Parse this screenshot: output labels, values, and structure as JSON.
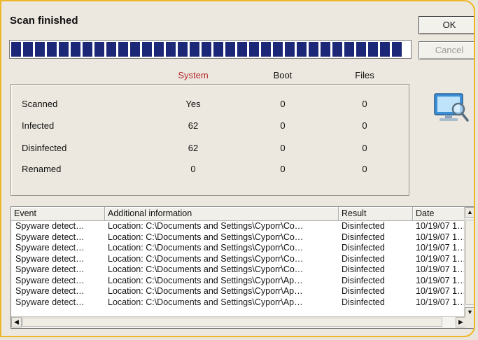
{
  "dialog": {
    "title": "Scan finished",
    "ok_label": "OK",
    "cancel_label": "Cancel",
    "progress": 1.0,
    "accent_color": "#f0b62a",
    "progress_color": "#1d2777"
  },
  "stats": {
    "columns": [
      "System",
      "Boot",
      "Files"
    ],
    "rows": [
      {
        "label": "Scanned",
        "system": "Yes",
        "boot": "0",
        "files": "0"
      },
      {
        "label": "Infected",
        "system": "62",
        "boot": "0",
        "files": "0"
      },
      {
        "label": "Disinfected",
        "system": "62",
        "boot": "0",
        "files": "0"
      },
      {
        "label": "Renamed",
        "system": "0",
        "boot": "0",
        "files": "0"
      }
    ]
  },
  "icon": "computer-magnifier-icon",
  "log": {
    "headers": [
      "Event",
      "Additional information",
      "Result",
      "Date"
    ],
    "rows": [
      [
        "Spyware detect…",
        "Location: C:\\Documents and Settings\\Cyporr\\Co…",
        "Disinfected",
        "10/19/07 1…"
      ],
      [
        "Spyware detect…",
        "Location: C:\\Documents and Settings\\Cyporr\\Co…",
        "Disinfected",
        "10/19/07 1…"
      ],
      [
        "Spyware detect…",
        "Location: C:\\Documents and Settings\\Cyporr\\Co…",
        "Disinfected",
        "10/19/07 1…"
      ],
      [
        "Spyware detect…",
        "Location: C:\\Documents and Settings\\Cyporr\\Co…",
        "Disinfected",
        "10/19/07 1…"
      ],
      [
        "Spyware detect…",
        "Location: C:\\Documents and Settings\\Cyporr\\Co…",
        "Disinfected",
        "10/19/07 1…"
      ],
      [
        "Spyware detect…",
        "Location: C:\\Documents and Settings\\Cyporr\\Ap…",
        "Disinfected",
        "10/19/07 1…"
      ],
      [
        "Spyware detect…",
        "Location: C:\\Documents and Settings\\Cyporr\\Ap…",
        "Disinfected",
        "10/19/07 1…"
      ],
      [
        "Spyware detect…",
        "Location: C:\\Documents and Settings\\Cyporr\\Ap…",
        "Disinfected",
        "10/19/07 1…"
      ]
    ]
  }
}
